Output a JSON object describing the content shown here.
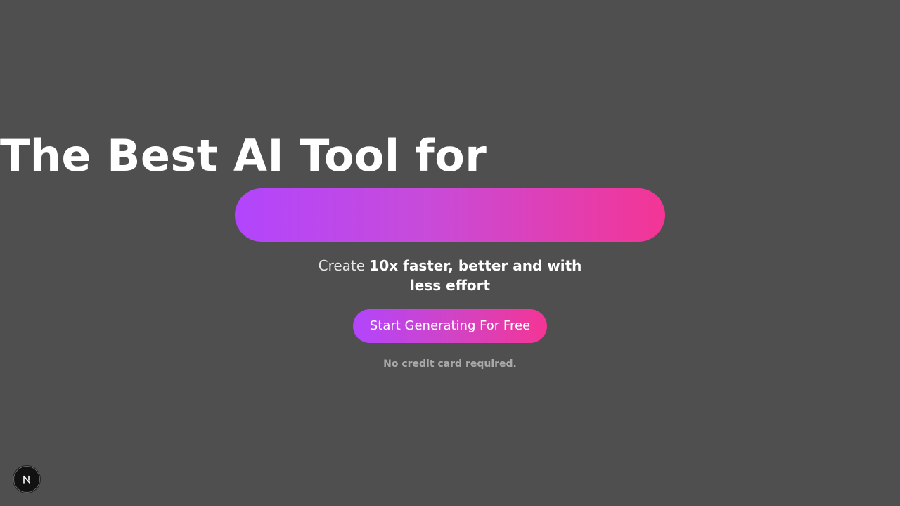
{
  "hero": {
    "headline": "The Best AI Tool for",
    "subhead_prefix": "Create ",
    "subhead_bold": "10x faster, better and with less effort",
    "cta_label": "Start Generating For Free",
    "note": "No credit card required."
  },
  "colors": {
    "background": "#4f4f4f",
    "gradient_start": "#b245fd",
    "gradient_end": "#f43595"
  },
  "dev_badge": {
    "icon": "nextjs-logo-icon"
  }
}
